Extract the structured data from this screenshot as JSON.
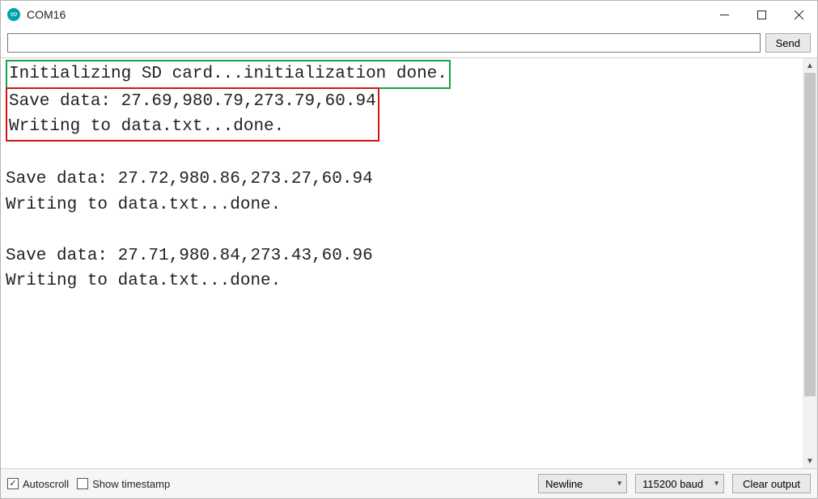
{
  "window": {
    "title": "COM16"
  },
  "sendrow": {
    "input_value": "",
    "input_placeholder": "",
    "send_label": "Send"
  },
  "output": {
    "line_init": "Initializing SD card...initialization done.",
    "block1_line1": "Save data: 27.69,980.79,273.79,60.94",
    "block1_line2": "Writing to data.txt...done.",
    "blank": "",
    "block2_line1": "Save data: 27.72,980.86,273.27,60.94",
    "block2_line2": "Writing to data.txt...done.",
    "block3_line1": "Save data: 27.71,980.84,273.43,60.96",
    "block3_line2": "Writing to data.txt...done."
  },
  "bottom": {
    "autoscroll_label": "Autoscroll",
    "autoscroll_checked": true,
    "timestamp_label": "Show timestamp",
    "timestamp_checked": false,
    "line_ending_selected": "Newline",
    "baud_selected": "115200 baud",
    "clear_label": "Clear output"
  }
}
